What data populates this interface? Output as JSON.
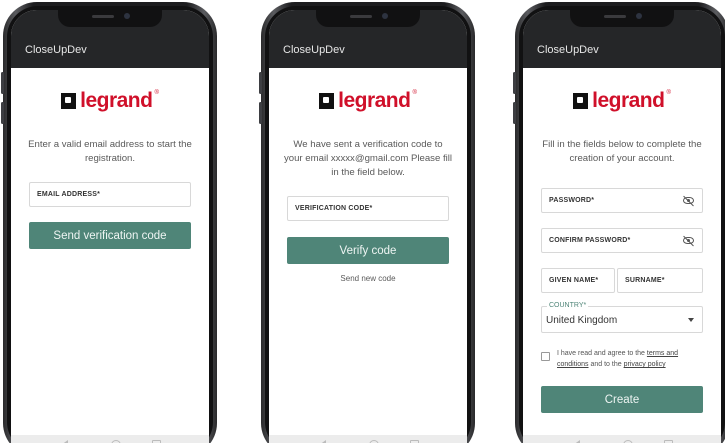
{
  "app": {
    "title": "CloseUpDev"
  },
  "brand": {
    "name": "legrand",
    "reg": "®",
    "color": "#d0102a",
    "accent": "#4f8578"
  },
  "screen1": {
    "message": "Enter a valid email address to start the registration.",
    "email_label": "EMAIL ADDRESS*",
    "send_button": "Send verification code"
  },
  "screen2": {
    "message": "We have sent a verification code to your email xxxxx@gmail.com Please fill in the field below.",
    "code_label": "VERIFICATION CODE*",
    "verify_button": "Verify code",
    "resend_link": "Send new code"
  },
  "screen3": {
    "message": "Fill in the fields below to complete the creation of your account.",
    "password_label": "PASSWORD*",
    "confirm_label": "CONFIRM PASSWORD*",
    "given_label": "GIVEN NAME*",
    "surname_label": "SURNAME*",
    "country_label": "COUNTRY*",
    "country_value": "United Kingdom",
    "agree_prefix": "I have read and agree to the",
    "terms_link": "terms and conditions",
    "agree_middle": "and to the",
    "privacy_link": "privacy policy",
    "create_button": "Create"
  },
  "icons": [
    "eye-off-icon",
    "chevron-down-icon",
    "nav-back-icon",
    "nav-home-icon",
    "nav-recent-icon"
  ]
}
